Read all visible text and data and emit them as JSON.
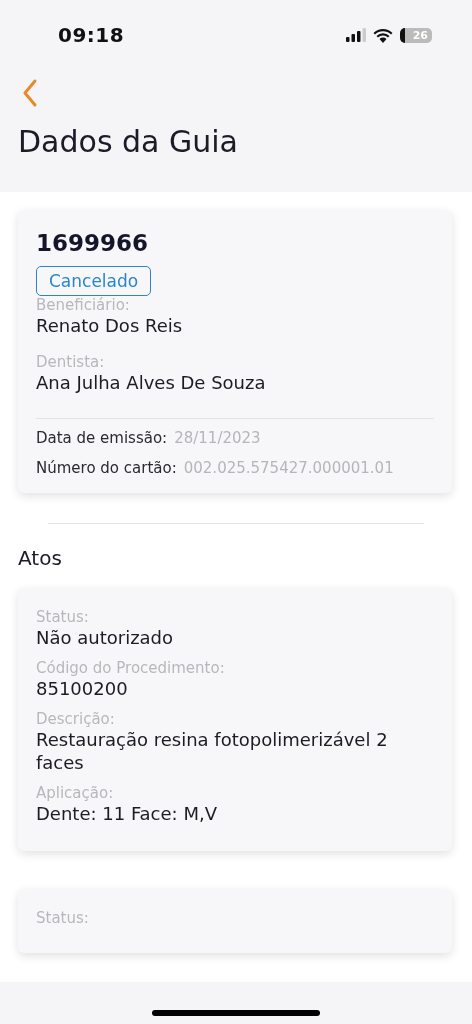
{
  "status_bar": {
    "time": "09:18",
    "battery": "26"
  },
  "header": {
    "title": "Dados da Guia"
  },
  "guide": {
    "number": "1699966",
    "status": {
      "label": "Cancelado",
      "kind": "cancelled"
    },
    "fields": [
      {
        "label": "Beneficiário:",
        "value": "Renato Dos Reis"
      },
      {
        "label": "Dentista:",
        "value": "Ana Julha Alves De Souza"
      }
    ],
    "details": [
      {
        "label": "Data de emissão:",
        "value": "28/11/2023"
      },
      {
        "label": "Número do cartão:",
        "value": "002.025.575427.000001.01"
      }
    ]
  },
  "section": {
    "title": "Atos"
  },
  "acts": [
    {
      "fields": [
        {
          "label": "Status:",
          "value": "Não autorizado"
        },
        {
          "label": "Código do Procedimento:",
          "value": "85100200"
        },
        {
          "label": "Descrição:",
          "value": "Restauração resina fotopolimerizável 2 faces"
        },
        {
          "label": "Aplicação:",
          "value": "Dente: 11 Face: M,V"
        }
      ]
    },
    {
      "fields": [
        {
          "label": "Status:"
        }
      ]
    }
  ]
}
